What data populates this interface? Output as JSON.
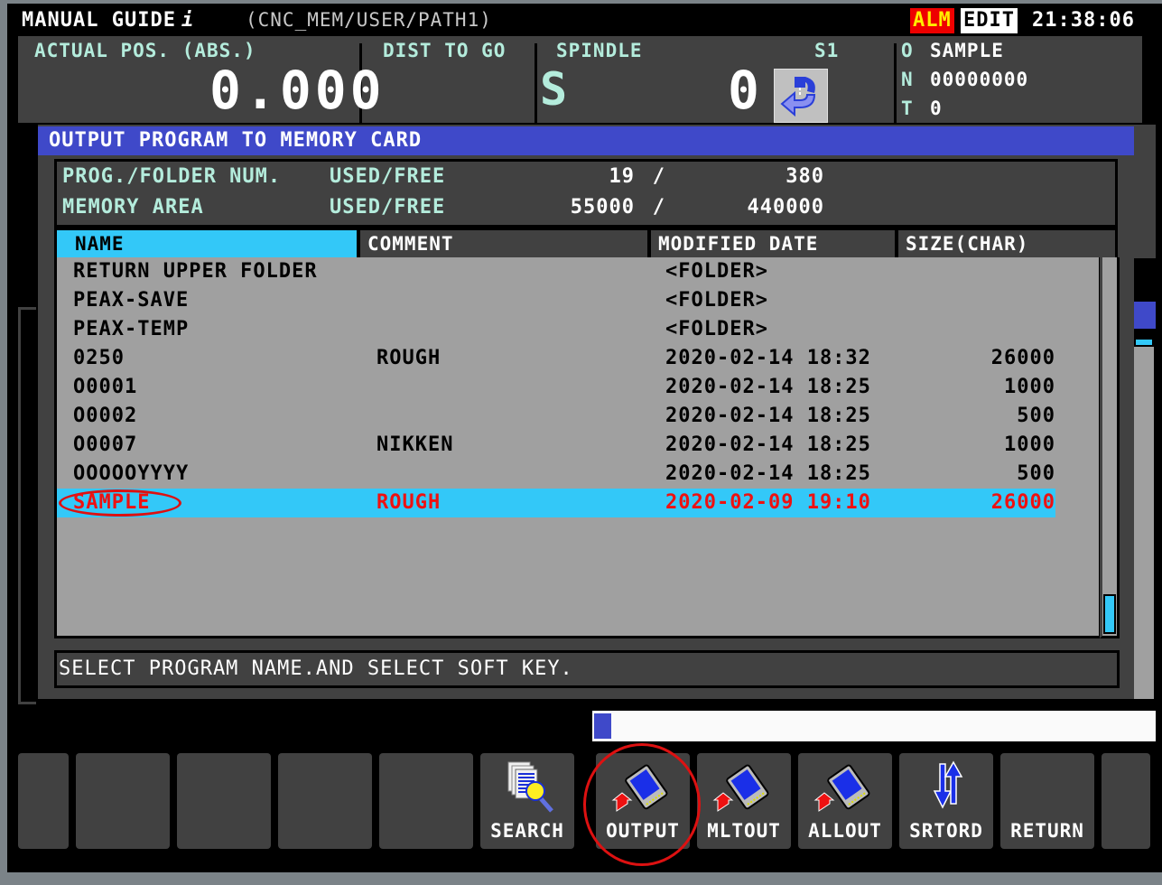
{
  "header": {
    "app_title": "MANUAL GUIDE",
    "app_title_suffix": "i",
    "path": "(CNC_MEM/USER/PATH1)",
    "alarm_badge": "ALM",
    "mode_badge": "EDIT",
    "clock": "21:38:06",
    "colors": {
      "alarm_bg": "#ee0000",
      "alarm_fg": "#ffee00",
      "mode_bg": "#ffffff"
    }
  },
  "status": {
    "actual_pos_label": "ACTUAL POS. (ABS.)",
    "actual_pos_value": "0.000",
    "dist_to_go_label": "DIST TO GO",
    "spindle_label": "SPINDLE",
    "spindle_id": "S1",
    "spindle_letter": "S",
    "spindle_value": "0",
    "spindle_icon": "spindle-rotation-icon",
    "o_label": "O",
    "o_value": "SAMPLE",
    "n_label": "N",
    "n_value": "00000000",
    "t_label": "T",
    "t_value": "0"
  },
  "dialog": {
    "title": "OUTPUT PROGRAM TO MEMORY CARD",
    "prog_folder_label": "PROG./FOLDER NUM.",
    "prog_folder_used_free_label": "USED/FREE",
    "prog_folder_used": "19",
    "prog_folder_free": "380",
    "memory_area_label": "MEMORY AREA",
    "memory_area_used_free_label": "USED/FREE",
    "memory_area_used": "55000",
    "memory_area_free": "440000",
    "separator": "/",
    "columns": [
      "NAME",
      "COMMENT",
      "MODIFIED DATE",
      "SIZE(CHAR)"
    ],
    "active_column": "NAME",
    "rows": [
      {
        "name": "RETURN UPPER FOLDER",
        "comment": "",
        "date": "<FOLDER>",
        "size": ""
      },
      {
        "name": "PEAX-SAVE",
        "comment": "",
        "date": "<FOLDER>",
        "size": ""
      },
      {
        "name": "PEAX-TEMP",
        "comment": "",
        "date": "<FOLDER>",
        "size": ""
      },
      {
        "name": "0250",
        "comment": "ROUGH",
        "date": "2020-02-14 18:32",
        "size": "26000"
      },
      {
        "name": "O0001",
        "comment": "",
        "date": "2020-02-14 18:25",
        "size": "1000"
      },
      {
        "name": "O0002",
        "comment": "",
        "date": "2020-02-14 18:25",
        "size": "500"
      },
      {
        "name": "O0007",
        "comment": "NIKKEN",
        "date": "2020-02-14 18:25",
        "size": "1000"
      },
      {
        "name": "OOOOOYYYY",
        "comment": "",
        "date": "2020-02-14 18:25",
        "size": "500"
      },
      {
        "name": "SAMPLE",
        "comment": "ROUGH",
        "date": "2020-02-09 19:10",
        "size": "26000",
        "selected": true
      }
    ],
    "message": "SELECT PROGRAM NAME.AND SELECT SOFT KEY.",
    "colors": {
      "title_bg": "#3f49c9",
      "selection_bg": "#33c8f8",
      "selection_fg": "#ee1111",
      "list_bg": "#a0a0a0"
    }
  },
  "progress": {
    "fraction": 0.03
  },
  "softkeys": [
    {
      "label": "",
      "icon": ""
    },
    {
      "label": "",
      "icon": ""
    },
    {
      "label": "",
      "icon": ""
    },
    {
      "label": "",
      "icon": ""
    },
    {
      "label": "",
      "icon": ""
    },
    {
      "label": "SEARCH",
      "icon": "search-documents-icon"
    },
    {
      "label": "OUTPUT",
      "icon": "memory-card-output-icon",
      "highlighted": true
    },
    {
      "label": "MLTOUT",
      "icon": "memory-card-output-icon"
    },
    {
      "label": "ALLOUT",
      "icon": "memory-card-output-icon"
    },
    {
      "label": "SRTORD",
      "icon": "sort-order-icon"
    },
    {
      "label": "RETURN",
      "icon": ""
    },
    {
      "label": "",
      "icon": ""
    }
  ]
}
